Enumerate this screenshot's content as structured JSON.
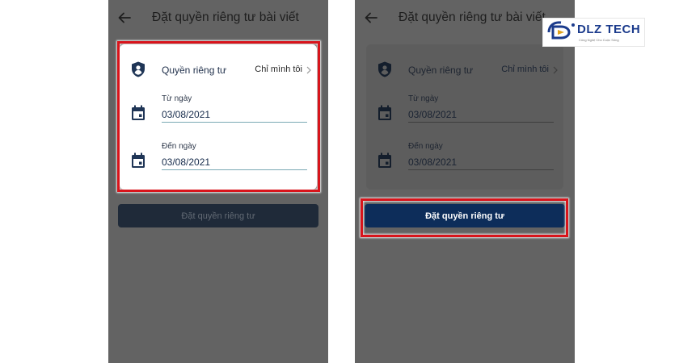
{
  "screen": {
    "title": "Đặt quyền riêng tư bài viết",
    "privacy_label": "Quyền riêng tư",
    "privacy_value": "Chỉ mình tôi",
    "from_label": "Từ ngày",
    "from_value": "03/08/2021",
    "to_label": "Đến ngày",
    "to_value": "03/08/2021",
    "action_button": "Đặt quyền riêng tư"
  },
  "watermark": {
    "brand": "DLZ TECH",
    "tagline": "Công Nghệ Cho Cuộc Sống"
  },
  "icons": [
    "back-arrow-icon",
    "shield-user-icon",
    "calendar-icon",
    "chevron-right-icon"
  ],
  "colors": {
    "highlight": "#d8141b",
    "primary_button": "#0d2d5a",
    "disabled_button": "#1f2a39",
    "overlay": "#636363"
  }
}
